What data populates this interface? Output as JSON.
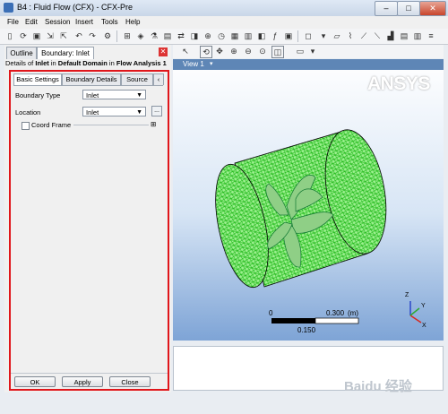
{
  "window": {
    "title": "B4 : Fluid Flow (CFX) - CFX-Pre",
    "min": "–",
    "max": "□",
    "close": "✕"
  },
  "menu": [
    "File",
    "Edit",
    "Session",
    "Insert",
    "Tools",
    "Help"
  ],
  "panel": {
    "tabs": [
      "Outline",
      "Boundary: Inlet"
    ],
    "details": {
      "prefix": "Details of ",
      "name": "Inlet",
      "in1": " in ",
      "domain": "Default Domain",
      "in2": " in ",
      "analysis": "Flow Analysis 1"
    },
    "subtabs": [
      "Basic Settings",
      "Boundary Details",
      "Source"
    ],
    "boundary_type_label": "Boundary Type",
    "boundary_type_value": "Inlet",
    "location_label": "Location",
    "location_value": "Inlet",
    "location_button": "...",
    "coord_frame_label": "Coord Frame",
    "coord_frame_expand": "⊞",
    "buttons": {
      "ok": "OK",
      "apply": "Apply",
      "close": "Close"
    }
  },
  "viewer": {
    "view_label": "View 1",
    "brand": "ANSYS",
    "scale": {
      "zero": "0",
      "major": "0.300",
      "unit": "(m)",
      "minor": "0.150"
    },
    "axis_labels": {
      "z": "Z",
      "y": "Y",
      "x": "X"
    },
    "mesh_color": "#22d81c",
    "axis_colors": {
      "x": "#d9261c",
      "y": "#2fa833",
      "z": "#2b47c8"
    }
  },
  "watermark": "Baidu 经验"
}
